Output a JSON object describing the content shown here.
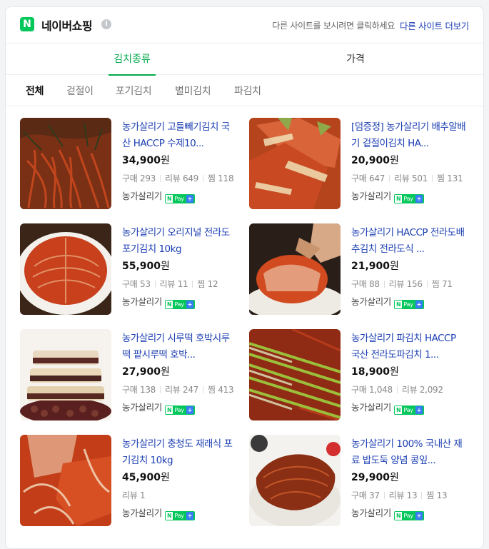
{
  "header": {
    "logo_glyph": "N",
    "title": "네이버쇼핑",
    "info_glyph": "i",
    "notice": "다른 사이트를 보시려면 클릭하세요",
    "more_link": "다른 사이트 더보기"
  },
  "tabs": [
    {
      "label": "김치종류",
      "selected": true
    },
    {
      "label": "가격",
      "selected": false
    }
  ],
  "filters": [
    {
      "label": "전체",
      "selected": true
    },
    {
      "label": "겉절이",
      "selected": false
    },
    {
      "label": "포기김치",
      "selected": false
    },
    {
      "label": "별미김치",
      "selected": false
    },
    {
      "label": "파김치",
      "selected": false
    }
  ],
  "badge": {
    "n": "N",
    "pay": "Pay",
    "plus": "+"
  },
  "labels": {
    "won": "원",
    "purchases": "구매",
    "reviews": "리뷰",
    "wish": "찜"
  },
  "products": [
    {
      "name": "농가살리기 고들빼기김치 국산 HACCP 수제10...",
      "price": "34,900",
      "purchases": "293",
      "reviews": "649",
      "wish": "118",
      "seller": "농가살리기",
      "image": "gochugaru-coated-leaf-kimchi"
    },
    {
      "name": "[덤증정] 농가살리기 배추알배기 겉절이김치 HA...",
      "price": "20,900",
      "purchases": "647",
      "reviews": "501",
      "wish": "131",
      "seller": "농가살리기",
      "image": "geotjeori-kimchi"
    },
    {
      "name": "농가살리기 오리지널 전라도 포기김치 10kg",
      "price": "55,900",
      "purchases": "53",
      "reviews": "11",
      "wish": "12",
      "seller": "농가살리기",
      "image": "pogi-kimchi-plate"
    },
    {
      "name": "농가살리기 HACCP 전라도배추김치 전라도식 ...",
      "price": "21,900",
      "purchases": "88",
      "reviews": "156",
      "wish": "71",
      "seller": "농가살리기",
      "image": "baechu-kimchi-hand"
    },
    {
      "name": "농가살리기 시루떡 호박시루떡 팥시루떡 호박...",
      "price": "27,900",
      "purchases": "138",
      "reviews": "247",
      "wish": "413",
      "seller": "농가살리기",
      "image": "sirutteok"
    },
    {
      "name": "농가살리기 파김치 HACCP 국산 전라도파김치 1...",
      "price": "18,900",
      "purchases": "1,048",
      "reviews": "2,092",
      "wish": null,
      "seller": "농가살리기",
      "image": "pa-kimchi"
    },
    {
      "name": "농가살리기 충청도 재래식 포기김치 10kg",
      "price": "45,900",
      "purchases": null,
      "reviews": "1",
      "wish": null,
      "seller": "농가살리기",
      "image": "chungcheong-pogi-kimchi"
    },
    {
      "name": "농가살리기 100% 국내산 재료 밥도둑 양념 콩잎...",
      "price": "29,900",
      "purchases": "37",
      "reviews": "13",
      "wish": "13",
      "seller": "농가살리기",
      "image": "kongip-kimchi"
    }
  ]
}
